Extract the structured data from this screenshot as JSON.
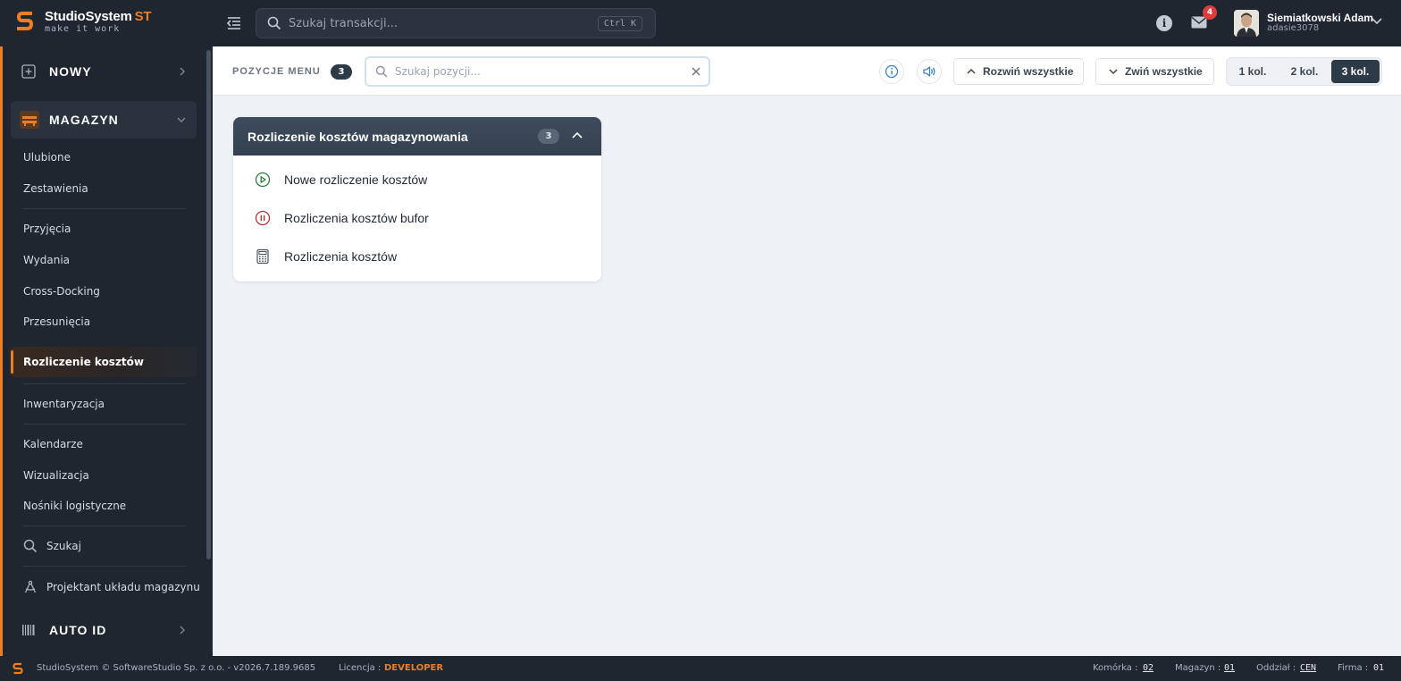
{
  "app": {
    "title": "StudioSystem",
    "title_suffix": "ST",
    "tagline": "make it work"
  },
  "topbar": {
    "search_placeholder": "Szukaj transakcji...",
    "search_shortcut": "Ctrl K",
    "mail_badge": "4",
    "user_name": "Siemiatkowski Adam",
    "user_login": "adasie3078"
  },
  "sidebar": {
    "sections": {
      "nowy": "NOWY",
      "magazyn": "MAGAZYN",
      "auto_id": "AUTO ID"
    },
    "items": [
      "Ulubione",
      "Zestawienia",
      "Przyjęcia",
      "Wydania",
      "Cross-Docking",
      "Przesunięcia",
      "Rozliczenie kosztów",
      "Inwentaryzacja",
      "Kalendarze",
      "Wizualizacja",
      "Nośniki logistyczne",
      "Szukaj",
      "Projektant układu magazynu"
    ],
    "active_item": "Rozliczenie kosztów"
  },
  "toolbar": {
    "label": "POZYCJE MENU",
    "count": "3",
    "search_placeholder": "Szukaj pozycji...",
    "expand_all": "Rozwiń wszystkie",
    "collapse_all": "Zwiń wszystkie",
    "columns": [
      "1 kol.",
      "2 kol.",
      "3 kol."
    ],
    "active_columns": "3 kol."
  },
  "card": {
    "title": "Rozliczenie kosztów magazynowania",
    "count": "3",
    "items": [
      {
        "label": "Nowe rozliczenie kosztów",
        "icon": "play-circle-icon",
        "color": "#2f7d3a"
      },
      {
        "label": "Rozliczenia kosztów bufor",
        "icon": "pause-circle-icon",
        "color": "#b3313b"
      },
      {
        "label": "Rozliczenia kosztów",
        "icon": "calculator-icon",
        "color": "#4b5563"
      }
    ]
  },
  "footer": {
    "copyright": "StudioSystem © SoftwareStudio Sp. z o.o. - v2026.7.189.9685",
    "license_label": "Licencja :",
    "license_value": "DEVELOPER",
    "komorka_label": "Komórka :",
    "komorka_value": "02",
    "magazyn_label": "Magazyn :",
    "magazyn_value": "01",
    "oddzial_label": "Oddział :",
    "oddzial_value": "CEN",
    "firma_label": "Firma :",
    "firma_value": "01"
  },
  "colors": {
    "accent": "#f07d22",
    "dark": "#1f2630",
    "card_header": "#334151",
    "badge": "#e03c3c"
  }
}
